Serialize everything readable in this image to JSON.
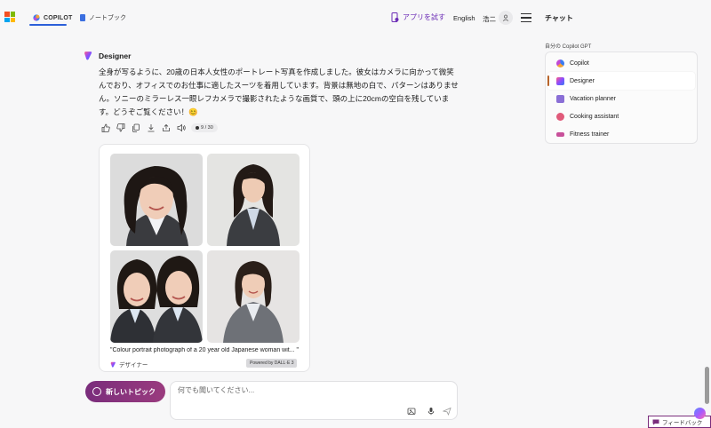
{
  "header": {
    "tabs": [
      {
        "label": "COPILOT",
        "active": true
      },
      {
        "label": "ノートブック",
        "active": false
      }
    ],
    "try_app": "アプリを試す",
    "language": "English",
    "user_name": "浩二"
  },
  "sidebar": {
    "title": "チャット",
    "section_label": "自分の Copilot GPT",
    "gpts": [
      {
        "label": "Copilot",
        "icon": "copilot-icon",
        "active": false
      },
      {
        "label": "Designer",
        "icon": "designer-icon",
        "active": true
      },
      {
        "label": "Vacation planner",
        "icon": "suitcase-icon",
        "active": false
      },
      {
        "label": "Cooking assistant",
        "icon": "cooking-pot-icon",
        "active": false
      },
      {
        "label": "Fitness trainer",
        "icon": "dumbbell-icon",
        "active": false
      }
    ]
  },
  "message": {
    "author": "Designer",
    "text": "全身が写るように、20歳の日本人女性のポートレート写真を作成しました。彼女はカメラに向かって微笑んでおり、オフィスでのお仕事に適したスーツを着用しています。背景は無地の白で、パターンはありません。ソニーのミラーレス一眼レフカメラで撮影されたような画質で、頭の上に20cmの空白を残しています。どうぞご覧ください！😊",
    "counter": "9 / 30"
  },
  "image_card": {
    "caption": "\"Colour portrait photograph of a 20 year old Japanese woman wit... \"",
    "credit": "デザイナー",
    "powered_by": "Powered by DALL·E 3"
  },
  "composer": {
    "new_topic": "新しいトピック",
    "placeholder": "何でも聞いてください..."
  },
  "feedback": {
    "label": "フィードバック"
  },
  "colors": {
    "accent": "#2b5fd9",
    "brand_purple": "#7a2d7c",
    "try_app": "#6b2bb5"
  }
}
